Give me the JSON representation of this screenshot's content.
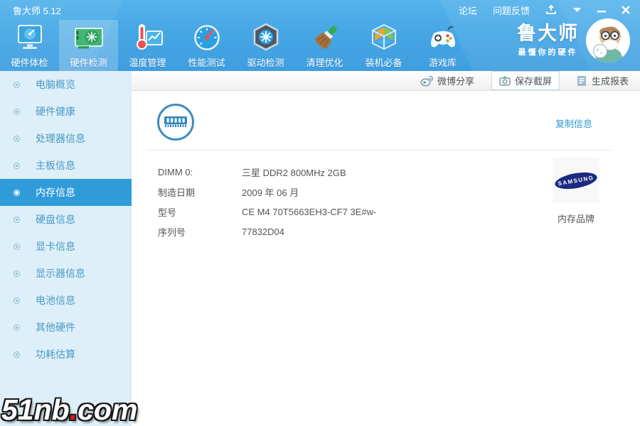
{
  "titlebar": {
    "title": "鲁大师 5.12",
    "links": [
      {
        "label": "论坛"
      },
      {
        "label": "问题反馈"
      }
    ]
  },
  "toolbar": {
    "tabs": [
      {
        "label": "硬件体检",
        "active": false
      },
      {
        "label": "硬件检测",
        "active": true
      },
      {
        "label": "温度管理",
        "active": false
      },
      {
        "label": "性能测试",
        "active": false
      },
      {
        "label": "驱动检测",
        "active": false
      },
      {
        "label": "清理优化",
        "active": false
      },
      {
        "label": "装机必备",
        "active": false
      },
      {
        "label": "游戏库",
        "active": false
      }
    ],
    "brand": {
      "name": "鲁大师",
      "slogan": "最懂你的硬件"
    }
  },
  "actionbar": {
    "items": [
      {
        "label": "微博分享",
        "icon": "weibo-icon"
      },
      {
        "label": "保存截屏",
        "icon": "camera-icon"
      },
      {
        "label": "生成报表",
        "icon": "report-icon"
      }
    ]
  },
  "sidebar": {
    "items": [
      {
        "label": "电脑概览",
        "selected": false
      },
      {
        "label": "硬件健康",
        "selected": false
      },
      {
        "label": "处理器信息",
        "selected": false
      },
      {
        "label": "主板信息",
        "selected": false
      },
      {
        "label": "内存信息",
        "selected": true
      },
      {
        "label": "硬盘信息",
        "selected": false
      },
      {
        "label": "显卡信息",
        "selected": false
      },
      {
        "label": "显示器信息",
        "selected": false
      },
      {
        "label": "电池信息",
        "selected": false
      },
      {
        "label": "其他硬件",
        "selected": false
      },
      {
        "label": "功耗估算",
        "selected": false
      }
    ]
  },
  "content": {
    "copy_link": "复制信息",
    "rows": [
      {
        "label": "DIMM 0:",
        "value": "三星 DDR2 800MHz 2GB"
      },
      {
        "label": "制造日期",
        "value": "2009 年 06 月"
      },
      {
        "label": "型号",
        "value": "CE M4 70T5663EH3-CF7 3E#w-"
      },
      {
        "label": "序列号",
        "value": "77832D04"
      }
    ],
    "brand": {
      "logo_text": "SAMSUNG",
      "caption": "内存品牌"
    }
  },
  "watermark": {
    "left": "51nb",
    "dot": ".",
    "right": "com"
  },
  "colors": {
    "header_top": "#55b3ec",
    "header_bottom": "#3f9edf",
    "sidebar_bg": "#ddeff8",
    "selected_item": "#2f9cd9",
    "sidebar_text": "#4b9ac6",
    "link": "#2d9bd3",
    "samsung_navy": "#1b2b80",
    "watermark_dot": "#e31414"
  }
}
